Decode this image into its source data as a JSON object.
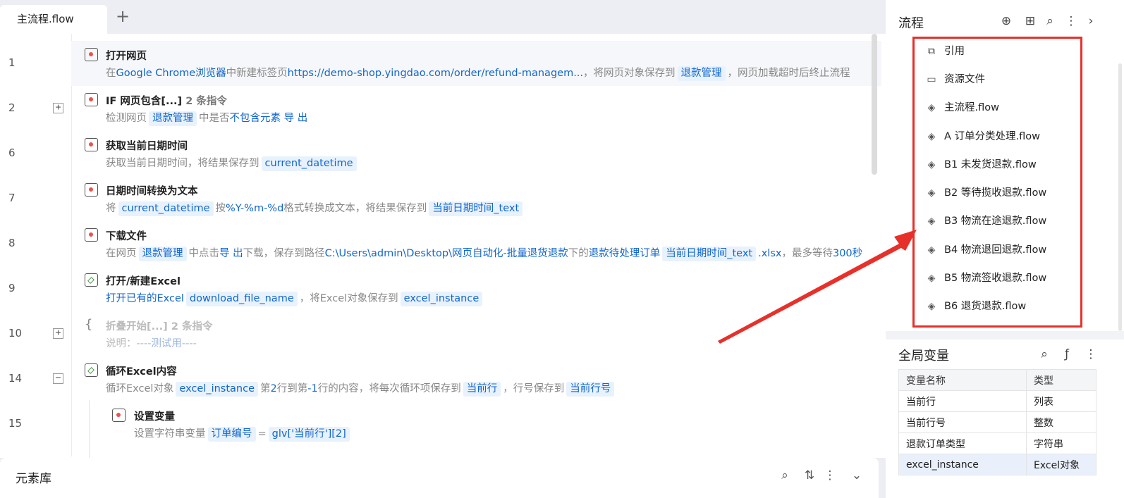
{
  "tabs": {
    "active_label": "主流程.flow",
    "add_label": "+"
  },
  "rows": [
    {
      "line": "1",
      "title": "打开网页",
      "desc": {
        "p0": "在",
        "b0": "Google Chrome浏览器",
        "p1": "中新建标签页",
        "b1": "https://demo-shop.yingdao.com/order/refund-managem...",
        "p2": "，将网页对象保存到",
        "t0": "退款管理",
        "p3": "，网页加载超时后终止流程"
      }
    },
    {
      "line": "2",
      "expander": "+",
      "title": "IF 网页包含[...]",
      "count": "2 条指令",
      "desc": {
        "p0": "检测网页",
        "t0": "退款管理",
        "p1": "中是否",
        "b0": "不包含元素 导 出"
      }
    },
    {
      "line": "6",
      "title": "获取当前日期时间",
      "desc": {
        "p0": "获取当前日期时间，将结果保存到",
        "t0": "current_datetime"
      }
    },
    {
      "line": "7",
      "title": "日期时间转换为文本",
      "desc": {
        "p0": "将",
        "t0": "current_datetime",
        "p1": "按",
        "b0": "%Y-%m-%d",
        "p2": "格式转换成文本，将结果保存到",
        "t1": "当前日期时间_text"
      }
    },
    {
      "line": "8",
      "title": "下载文件",
      "desc": {
        "p0": "在网页",
        "t0": "退款管理",
        "p1": "中点击",
        "b0": "导 出",
        "p2": "下载，保存到路径",
        "b1": "C:\\Users\\admin\\Desktop\\网页自动化-批量退货退款",
        "p3": "下的",
        "b2": "退款待处理订单",
        "t1": "当前日期时间_text",
        "b3": ".xlsx",
        "p4": "，最多等待",
        "b4": "300秒"
      }
    },
    {
      "line": "9",
      "title": "打开/新建Excel",
      "desc": {
        "b0": "打开已有的Excel",
        "t0": "download_file_name",
        "p0": "，将Excel对象保存到",
        "t1": "excel_instance"
      }
    },
    {
      "line": "10",
      "expander": "+",
      "title": "折叠开始[...]",
      "count": "2 条指令",
      "desc": {
        "p0": "说明：",
        "b0": "----测试用----"
      }
    },
    {
      "line": "14",
      "expander": "−",
      "title": "循环Excel内容",
      "desc": {
        "p0": "循环Excel对象",
        "t0": "excel_instance",
        "p1": "第",
        "b0": "2",
        "p2": "行到第",
        "b1": "-1",
        "p3": "行的内容，将每次循环项保存到",
        "t1": "当前行",
        "p4": "，行号保存到",
        "t2": "当前行号"
      }
    },
    {
      "line": "15",
      "title": "设置变量",
      "desc": {
        "p0": "设置字符串变量",
        "t0": "订单编号",
        "p1": "=",
        "t1": "glv['当前行'][2]"
      }
    }
  ],
  "bottom_panel": {
    "title": "元素库"
  },
  "right_panel": {
    "flow_title": "流程",
    "flow_items": [
      "引用",
      "资源文件",
      "主流程.flow",
      "A 订单分类处理.flow",
      "B1 未发货退款.flow",
      "B2 等待揽收退款.flow",
      "B3 物流在途退款.flow",
      "B4 物流退回退款.flow",
      "B5 物流签收退款.flow",
      "B6 退货退款.flow"
    ],
    "globals_title": "全局变量",
    "table_headers": [
      "变量名称",
      "类型"
    ],
    "table_rows": [
      [
        "当前行",
        "列表"
      ],
      [
        "当前行号",
        "整数"
      ],
      [
        "退款订单类型",
        "字符串"
      ],
      [
        "excel_instance",
        "Excel对象"
      ]
    ]
  },
  "colors": {
    "accent_blue": "#1166cc",
    "annotation_red": "#e8302a",
    "tag_bg": "#e8f2fd"
  }
}
